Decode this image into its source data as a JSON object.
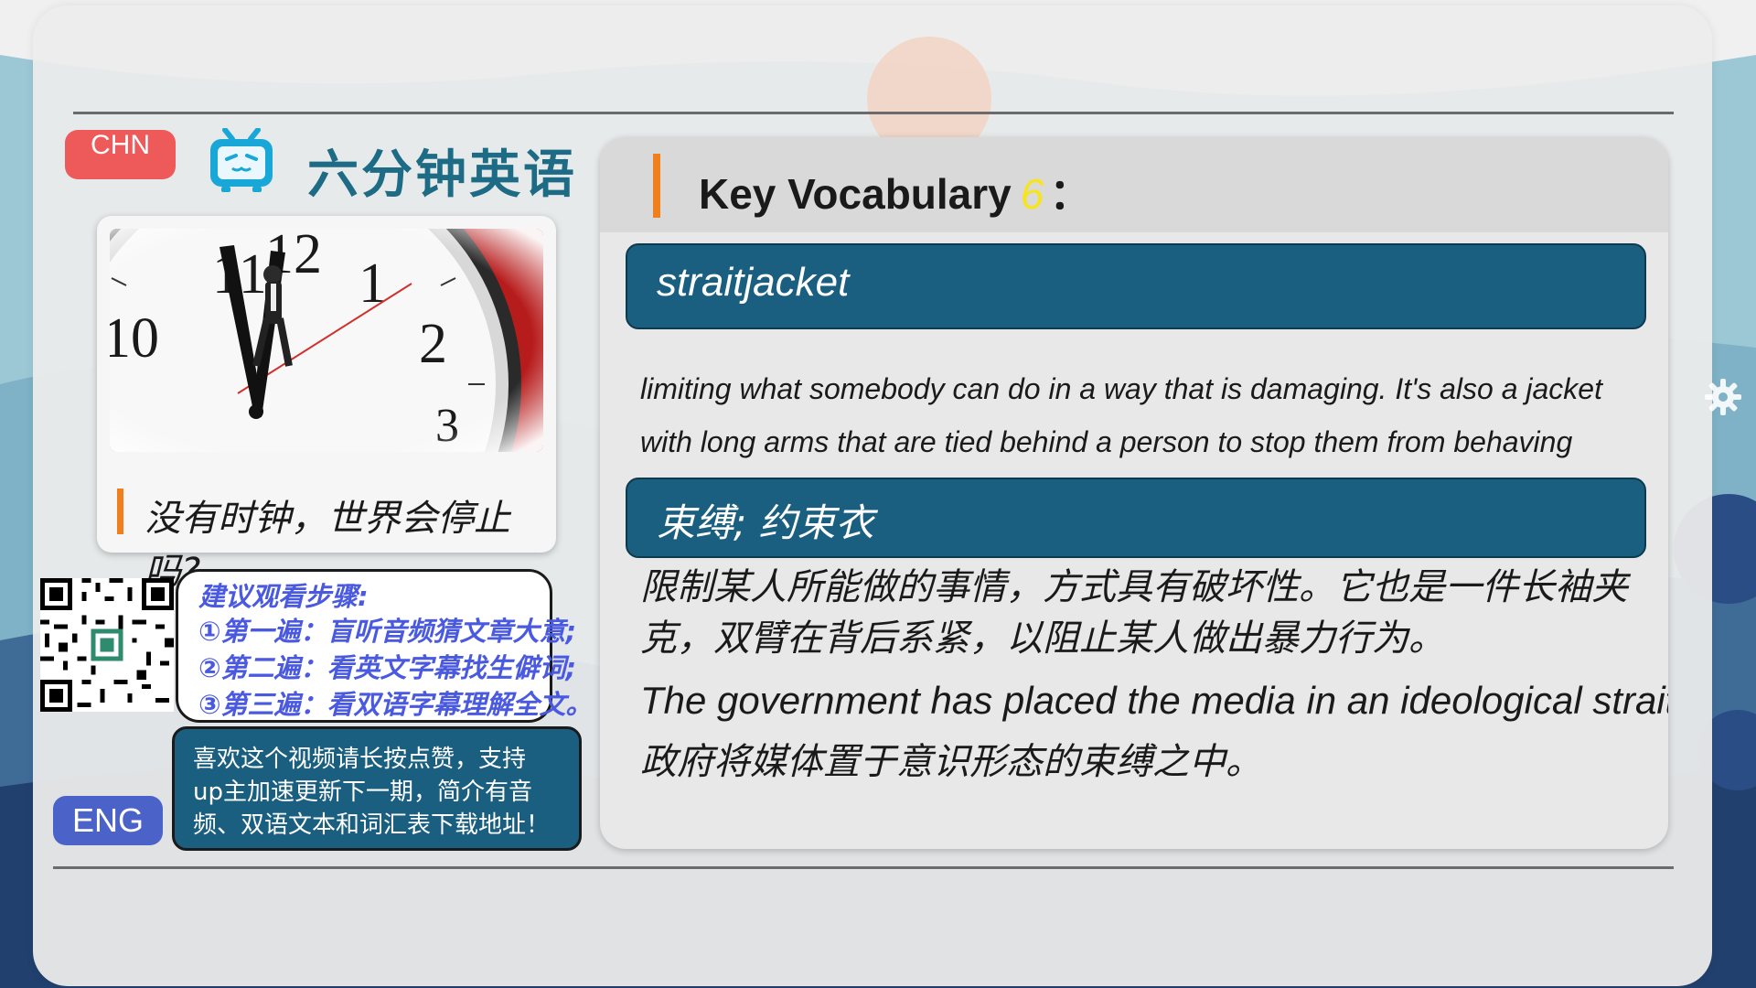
{
  "colors": {
    "accent_orange": "#f07f1e",
    "band_blue": "#1a5f80",
    "brand_teal": "#1d6b84",
    "chn_red": "#ee5a5a",
    "eng_blue": "#4b63c9",
    "steps_text": "#4a5ae0",
    "highlight_yellow": "#f7e51a"
  },
  "lang_buttons": {
    "chn": "CHN",
    "eng": "ENG"
  },
  "brand": {
    "icon": "bilibili-tv-icon",
    "title": "六分钟英语"
  },
  "episode": {
    "image": "clock-businessman-image",
    "caption": "没有时钟，世界会停止吗?"
  },
  "qr": {
    "icon": "qr-code-icon"
  },
  "steps": {
    "title": "建议观看步骤:",
    "items": [
      "①第一遍：盲听音频猜文章大意;",
      "②第二遍：看英文字幕找生僻词;",
      "③第三遍：看双语字幕理解全文。"
    ]
  },
  "like_box": {
    "lines": [
      "喜欢这个视频请长按点赞，支持",
      "up主加速更新下一期，简介有音",
      "频、双语文本和词汇表下载地址！"
    ]
  },
  "vocab": {
    "heading": "Key Vocabulary",
    "number": "6",
    "colon": "：",
    "word": "straitjacket",
    "definition_en": "limiting what somebody can do in a way that is damaging. It's also a jacket with long arms that are tied behind a person to stop them from behaving violently",
    "translation": "束缚; 约束衣",
    "definition_zh": "限制某人所能做的事情，方式具有破坏性。它也是一件长袖夹克，双臂在背后系紧，以阻止某人做出暴力行为。",
    "example_en": "The government has placed the media in an ideological straitjacket.",
    "example_zh": "政府将媒体置于意识形态的束缚之中。"
  },
  "decor": {
    "gear": "gear-icon"
  }
}
